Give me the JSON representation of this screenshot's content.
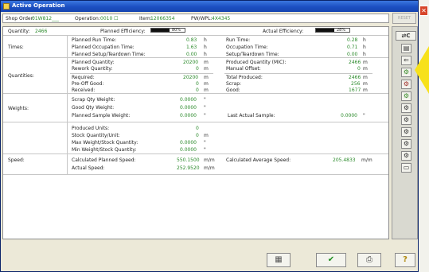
{
  "window": {
    "title": "Active Operation",
    "close_glyph": "✕"
  },
  "header": {
    "shop_order_label": "Shop Order:",
    "shop_order_value": "01W812___",
    "operation_label": "Operation:",
    "operation_value": "0010 ☐",
    "item_label": "Item:",
    "item_value": "12066354",
    "pw_label": "PW/WPL:",
    "pw_value": "4X4345",
    "reset_button": "RESET"
  },
  "quantity_row": {
    "quantity_label": "Quantity:",
    "quantity_value": "2466",
    "planned_eff_label": "Planned Efficiency:",
    "planned_eff_pct": "80%",
    "planned_eff_fill": 0.55,
    "actual_eff_label": "Actual Efficiency:",
    "actual_eff_pct": "28%",
    "actual_eff_fill": 0.55
  },
  "times": {
    "section": "Times:",
    "left": [
      {
        "label": "Planned Run Time:",
        "value": "0.83",
        "unit": "h"
      },
      {
        "label": "Planned Occupation Time:",
        "value": "1.63",
        "unit": "h"
      },
      {
        "label": "Planned Setup/Teardown Time:",
        "value": "0.00",
        "unit": "h"
      }
    ],
    "right": [
      {
        "label": "Run Time:",
        "value": "0.28",
        "unit": "h"
      },
      {
        "label": "Occupation Time:",
        "value": "0.71",
        "unit": "h"
      },
      {
        "label": "Setup/Teardown Time:",
        "value": "0.00",
        "unit": "h"
      }
    ]
  },
  "quantities": {
    "section": "Quantities:",
    "top_left": [
      {
        "label": "Planned Quantity:",
        "value": "20200",
        "unit": "m"
      },
      {
        "label": "Rework Quantity:",
        "value": "0",
        "unit": "m"
      }
    ],
    "top_right": [
      {
        "label": "Produced Quantity (MIC):",
        "value": "2466",
        "unit": "m"
      },
      {
        "label": "Manual Offset:",
        "value": "0",
        "unit": "m"
      }
    ],
    "bottom_left": [
      {
        "label": "Required:",
        "value": "20200",
        "unit": "m"
      },
      {
        "label": "Pre-Off Good:",
        "value": "0",
        "unit": "m"
      },
      {
        "label": "Received:",
        "value": "0",
        "unit": "m"
      }
    ],
    "bottom_right": [
      {
        "label": "Total Produced:",
        "value": "2466",
        "unit": "m"
      },
      {
        "label": "Scrap:",
        "value": "256",
        "unit": "m"
      },
      {
        "label": "Good:",
        "value": "1677",
        "unit": "m"
      }
    ]
  },
  "weights": {
    "section": "Weights:",
    "left": [
      {
        "label": "Scrap Qty Weight:",
        "value": "0.0000",
        "unit": "\""
      },
      {
        "label": "Good Qty Weight:",
        "value": "0.0000",
        "unit": "\""
      },
      {
        "label": "Planned Sample Weight:",
        "value": "0.0000",
        "unit": "\""
      }
    ],
    "last_sample_label": "Last Actual Sample:",
    "last_sample_value": "0.0000",
    "last_sample_unit": "\""
  },
  "units": {
    "rows": [
      {
        "label": "Produced Units:",
        "value": "0",
        "unit": ""
      },
      {
        "label": "Stock Quantity/Unit:",
        "value": "0",
        "unit": "m"
      },
      {
        "label": "Max Weight/Stock Quantity:",
        "value": "0.0000",
        "unit": "\""
      },
      {
        "label": "Min Weight/Stock Quantity:",
        "value": "0.0000",
        "unit": "\""
      }
    ]
  },
  "speed": {
    "section": "Speed:",
    "calc_label": "Calculated Planned Speed:",
    "calc_value": "550.1500",
    "calc_unit": "m/m",
    "avg_label": "Calculated Average Speed:",
    "avg_value": "205.4833",
    "avg_unit": "m/m",
    "actual_label": "Actual Speed:",
    "actual_value": "252.9520",
    "actual_unit": "m/m"
  },
  "sidebar": {
    "top_button": "⇄C",
    "buttons": [
      "▤",
      "⇐",
      "⚙",
      "⚙",
      "⚙",
      "⚙",
      "⚙",
      "⚙",
      "⚙",
      "⚙",
      "▭"
    ]
  },
  "bottom": {
    "grid_glyph": "▦",
    "ok_glyph": "✔",
    "print_glyph": "⎙",
    "help_glyph": "?"
  },
  "colors": {
    "title_bar": "#1c4fc2",
    "value_green": "#2b8a2b",
    "ok_green": "#1f8f1f",
    "pointer_yellow": "#f7e11a"
  }
}
